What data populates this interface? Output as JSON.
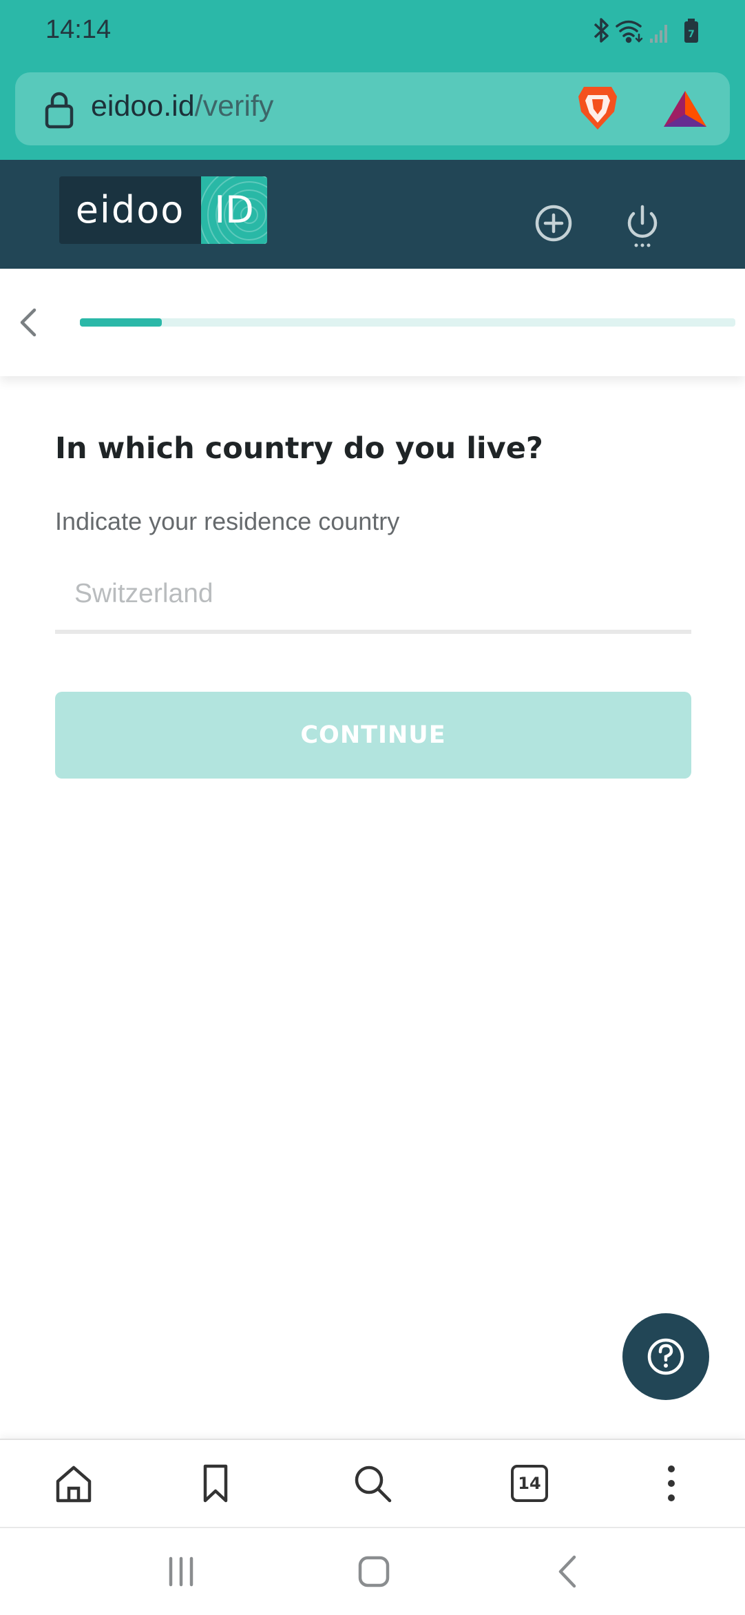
{
  "status_bar": {
    "time": "14:14",
    "icons": [
      "bluetooth-icon",
      "wifi-icon",
      "signal-icon",
      "battery-icon"
    ],
    "battery_level": "7"
  },
  "browser": {
    "url_domain": "eidoo.id",
    "url_path": "/verify",
    "extensions": [
      "brave-lion-icon",
      "bat-rewards-icon"
    ],
    "toolbar": {
      "tabs_count": "14",
      "buttons": [
        "home-icon",
        "bookmark-icon",
        "search-icon",
        "tabs-icon",
        "more-icon"
      ]
    }
  },
  "app": {
    "logo_word": "eidoo",
    "logo_id": "ID",
    "header_actions": [
      "add-circle-icon",
      "power-icon"
    ]
  },
  "progress": {
    "fraction": 0.125
  },
  "form": {
    "question": "In which country do you live?",
    "label": "Indicate your residence country",
    "country_placeholder": "Switzerland",
    "continue_label": "CONTINUE"
  },
  "colors": {
    "accent": "#2bb8a8",
    "header": "#224656",
    "button_disabled": "#b2e4de"
  }
}
